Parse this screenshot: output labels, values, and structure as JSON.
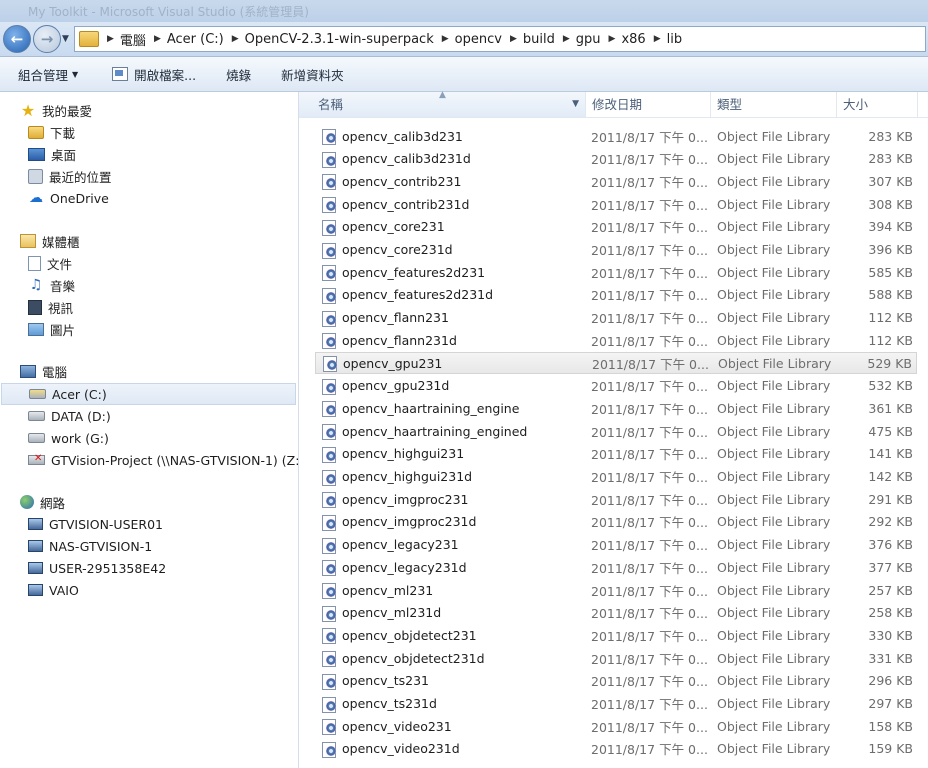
{
  "window": {
    "title": "My Toolkit - Microsoft Visual Studio (系統管理員)"
  },
  "address": {
    "crumbs": [
      "電腦",
      "Acer (C:)",
      "OpenCV-2.3.1-win-superpack",
      "opencv",
      "build",
      "gpu",
      "x86",
      "lib"
    ]
  },
  "toolbar": {
    "organize": "組合管理",
    "open": "開啟檔案...",
    "burn": "燒錄",
    "new_folder": "新增資料夾"
  },
  "sidebar": {
    "favorites": {
      "label": "我的最愛",
      "items": [
        "下載",
        "桌面",
        "最近的位置",
        "OneDrive"
      ]
    },
    "libraries": {
      "label": "媒體櫃",
      "items": [
        "文件",
        "音樂",
        "視訊",
        "圖片"
      ]
    },
    "computer": {
      "label": "電腦",
      "items": [
        "Acer (C:)",
        "DATA (D:)",
        "work (G:)",
        "GTVision-Project (\\\\NAS-GTVISION-1) (Z:)"
      ]
    },
    "network": {
      "label": "網路",
      "items": [
        "GTVISION-USER01",
        "NAS-GTVISION-1",
        "USER-2951358E42",
        "VAIO"
      ]
    }
  },
  "columns": {
    "name": "名稱",
    "date": "修改日期",
    "type": "類型",
    "size": "大小"
  },
  "files": [
    {
      "name": "opencv_calib3d231",
      "date": "2011/8/17 下午 0...",
      "type": "Object File Library",
      "size": "283 KB"
    },
    {
      "name": "opencv_calib3d231d",
      "date": "2011/8/17 下午 0...",
      "type": "Object File Library",
      "size": "283 KB"
    },
    {
      "name": "opencv_contrib231",
      "date": "2011/8/17 下午 0...",
      "type": "Object File Library",
      "size": "307 KB"
    },
    {
      "name": "opencv_contrib231d",
      "date": "2011/8/17 下午 0...",
      "type": "Object File Library",
      "size": "308 KB"
    },
    {
      "name": "opencv_core231",
      "date": "2011/8/17 下午 0...",
      "type": "Object File Library",
      "size": "394 KB"
    },
    {
      "name": "opencv_core231d",
      "date": "2011/8/17 下午 0...",
      "type": "Object File Library",
      "size": "396 KB"
    },
    {
      "name": "opencv_features2d231",
      "date": "2011/8/17 下午 0...",
      "type": "Object File Library",
      "size": "585 KB"
    },
    {
      "name": "opencv_features2d231d",
      "date": "2011/8/17 下午 0...",
      "type": "Object File Library",
      "size": "588 KB"
    },
    {
      "name": "opencv_flann231",
      "date": "2011/8/17 下午 0...",
      "type": "Object File Library",
      "size": "112 KB"
    },
    {
      "name": "opencv_flann231d",
      "date": "2011/8/17 下午 0...",
      "type": "Object File Library",
      "size": "112 KB"
    },
    {
      "name": "opencv_gpu231",
      "date": "2011/8/17 下午 0...",
      "type": "Object File Library",
      "size": "529 KB"
    },
    {
      "name": "opencv_gpu231d",
      "date": "2011/8/17 下午 0...",
      "type": "Object File Library",
      "size": "532 KB"
    },
    {
      "name": "opencv_haartraining_engine",
      "date": "2011/8/17 下午 0...",
      "type": "Object File Library",
      "size": "361 KB"
    },
    {
      "name": "opencv_haartraining_engined",
      "date": "2011/8/17 下午 0...",
      "type": "Object File Library",
      "size": "475 KB"
    },
    {
      "name": "opencv_highgui231",
      "date": "2011/8/17 下午 0...",
      "type": "Object File Library",
      "size": "141 KB"
    },
    {
      "name": "opencv_highgui231d",
      "date": "2011/8/17 下午 0...",
      "type": "Object File Library",
      "size": "142 KB"
    },
    {
      "name": "opencv_imgproc231",
      "date": "2011/8/17 下午 0...",
      "type": "Object File Library",
      "size": "291 KB"
    },
    {
      "name": "opencv_imgproc231d",
      "date": "2011/8/17 下午 0...",
      "type": "Object File Library",
      "size": "292 KB"
    },
    {
      "name": "opencv_legacy231",
      "date": "2011/8/17 下午 0...",
      "type": "Object File Library",
      "size": "376 KB"
    },
    {
      "name": "opencv_legacy231d",
      "date": "2011/8/17 下午 0...",
      "type": "Object File Library",
      "size": "377 KB"
    },
    {
      "name": "opencv_ml231",
      "date": "2011/8/17 下午 0...",
      "type": "Object File Library",
      "size": "257 KB"
    },
    {
      "name": "opencv_ml231d",
      "date": "2011/8/17 下午 0...",
      "type": "Object File Library",
      "size": "258 KB"
    },
    {
      "name": "opencv_objdetect231",
      "date": "2011/8/17 下午 0...",
      "type": "Object File Library",
      "size": "330 KB"
    },
    {
      "name": "opencv_objdetect231d",
      "date": "2011/8/17 下午 0...",
      "type": "Object File Library",
      "size": "331 KB"
    },
    {
      "name": "opencv_ts231",
      "date": "2011/8/17 下午 0...",
      "type": "Object File Library",
      "size": "296 KB"
    },
    {
      "name": "opencv_ts231d",
      "date": "2011/8/17 下午 0...",
      "type": "Object File Library",
      "size": "297 KB"
    },
    {
      "name": "opencv_video231",
      "date": "2011/8/17 下午 0...",
      "type": "Object File Library",
      "size": "158 KB"
    },
    {
      "name": "opencv_video231d",
      "date": "2011/8/17 下午 0...",
      "type": "Object File Library",
      "size": "159 KB"
    }
  ],
  "selected_file": "opencv_gpu231",
  "icons": {
    "back": "back-arrow-icon",
    "forward": "forward-arrow-icon",
    "file": "library-file-icon"
  }
}
